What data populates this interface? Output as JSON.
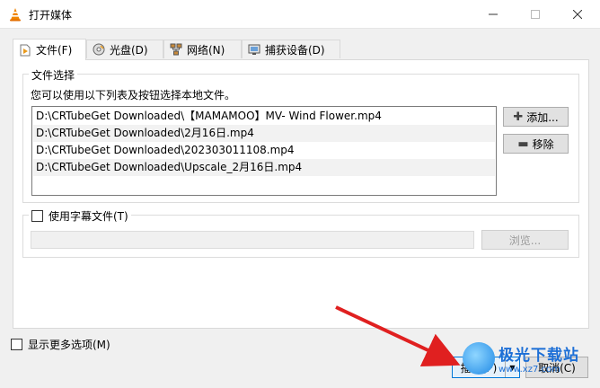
{
  "window": {
    "title": "打开媒体",
    "minimize_icon": "minimize-icon",
    "maximize_icon": "maximize-icon",
    "close_icon": "close-icon"
  },
  "tabs": [
    {
      "label": "文件(F)",
      "icon": "file-icon",
      "active": true
    },
    {
      "label": "光盘(D)",
      "icon": "disc-icon",
      "active": false
    },
    {
      "label": "网络(N)",
      "icon": "network-icon",
      "active": false
    },
    {
      "label": "捕获设备(D)",
      "icon": "capture-device-icon",
      "active": false
    }
  ],
  "file_selection": {
    "group_label": "文件选择",
    "hint": "您可以使用以下列表及按钮选择本地文件。",
    "files": [
      "D:\\CRTubeGet Downloaded\\【MAMAMOO】MV- Wind Flower.mp4",
      "D:\\CRTubeGet Downloaded\\2月16日.mp4",
      "D:\\CRTubeGet Downloaded\\202303011108.mp4",
      "D:\\CRTubeGet Downloaded\\Upscale_2月16日.mp4"
    ],
    "add_label": "添加...",
    "remove_label": "移除"
  },
  "subtitle": {
    "checkbox_label": "使用字幕文件(T)",
    "checked": false,
    "browse_label": "浏览..."
  },
  "more_options_label": "显示更多选项(M)",
  "play_label": "播放(P)",
  "cancel_label": "取消(C)",
  "watermark": {
    "title": "极光下载站",
    "url": "www.xz7.com"
  },
  "colors": {
    "accent": "#0078d7",
    "arrow": "#e02020"
  }
}
